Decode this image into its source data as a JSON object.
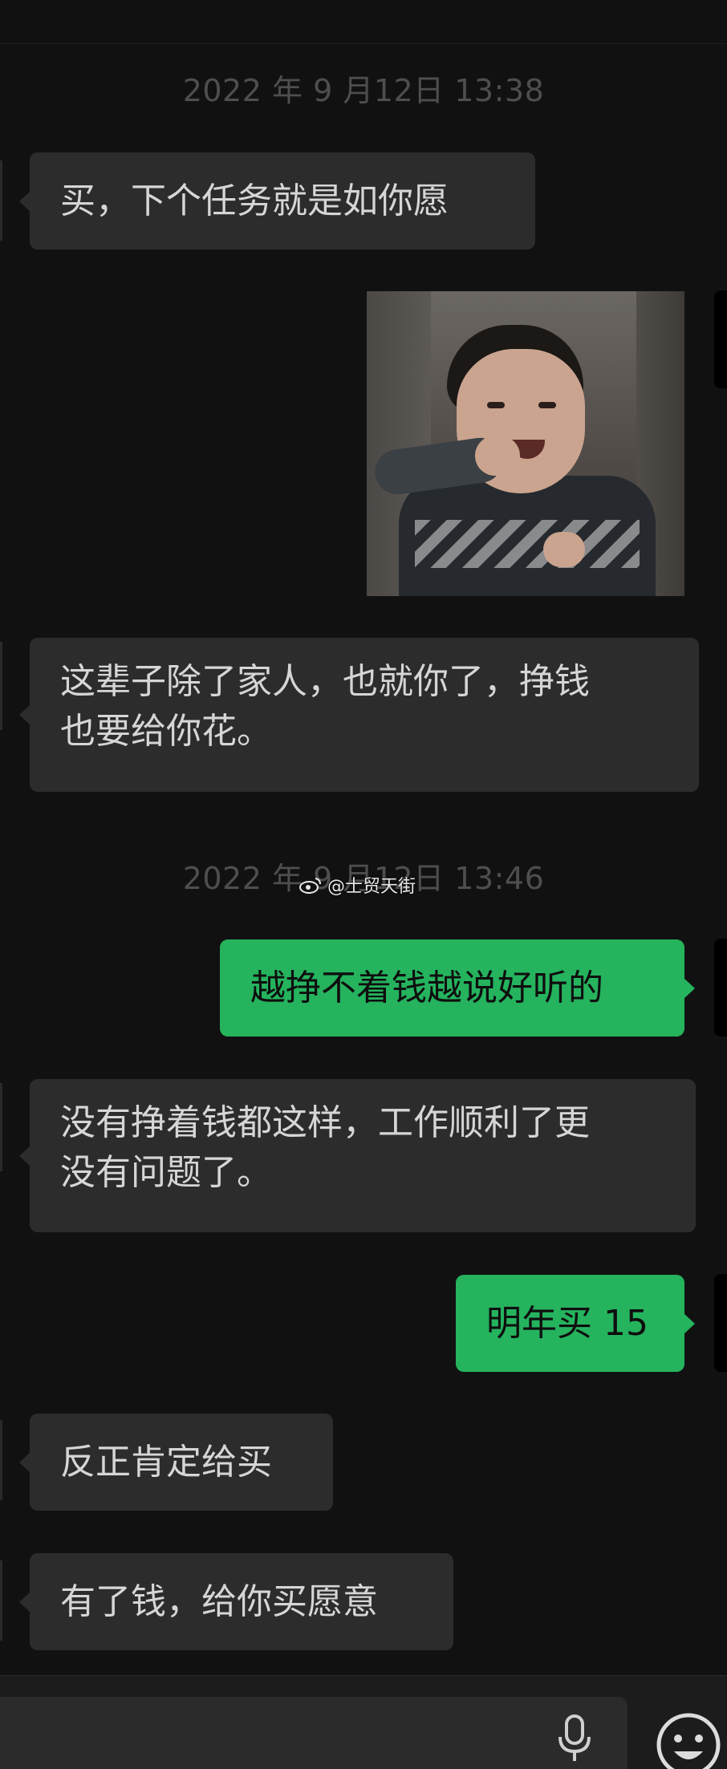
{
  "chat": {
    "timestamps": [
      "2022 年 9 月12日 13:38",
      "2022 年 9 月12日 13:46"
    ],
    "messages": [
      {
        "text": "买，下个任务就是如你愿"
      },
      {
        "image": "toddler-laughing-sticker"
      },
      {
        "line1": "这辈子除了家人，也就你了，挣钱",
        "line2": "也要给你花。"
      },
      {
        "text": "越挣不着钱越说好听的"
      },
      {
        "line1": "没有挣着钱都这样，工作顺利了更",
        "line2": "没有问题了。"
      },
      {
        "text": "明年买 15"
      },
      {
        "text": "反正肯定给买"
      },
      {
        "text": "有了钱，给你买愿意"
      }
    ],
    "colors": {
      "incoming_bubble": "#2c2c2c",
      "outgoing_bubble": "#25b35e",
      "background": "#111111"
    }
  },
  "watermark": {
    "text": "@士贸天街",
    "icon": "weibo-icon"
  },
  "input_bar": {
    "voice_icon": "mic-icon",
    "emoji_icon": "smiley-icon"
  }
}
